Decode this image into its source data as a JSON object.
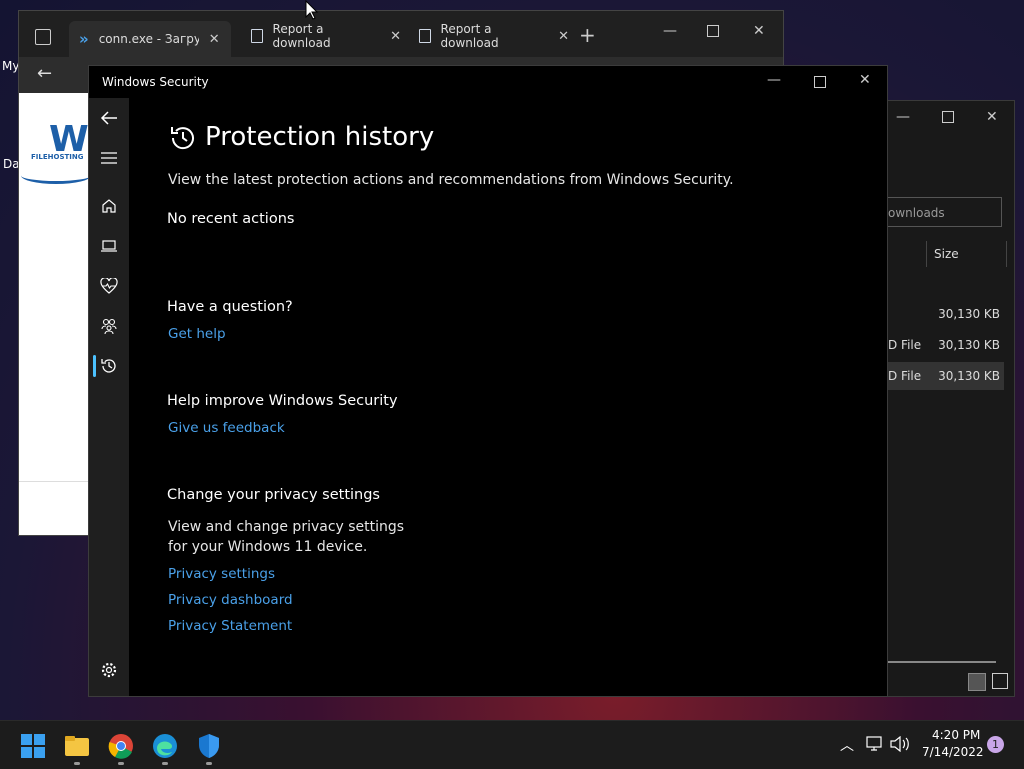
{
  "desktop": {
    "label_my": "My",
    "label_da": "Da"
  },
  "browser": {
    "tabs": [
      {
        "label": "conn.exe - Загрузи"
      },
      {
        "label": "Report a download"
      },
      {
        "label": "Report a download"
      }
    ],
    "logo_text": "W",
    "logo_sub": "FILEHOSTING"
  },
  "explorer": {
    "search_placeholder": "ownloads",
    "size_header": "Size",
    "rows": [
      {
        "type": "",
        "size": "30,130 KB"
      },
      {
        "type": "D File",
        "size": "30,130 KB"
      },
      {
        "type": "D File",
        "size": "30,130 KB"
      }
    ]
  },
  "security": {
    "window_title": "Windows Security",
    "page_title": "Protection history",
    "description": "View the latest protection actions and recommendations from Windows Security.",
    "no_actions": "No recent actions",
    "question_heading": "Have a question?",
    "get_help": "Get help",
    "improve_heading": "Help improve Windows Security",
    "feedback": "Give us feedback",
    "privacy_heading": "Change your privacy settings",
    "privacy_desc_1": "View and change privacy settings",
    "privacy_desc_2": "for your Windows 11 device.",
    "privacy_settings": "Privacy settings",
    "privacy_dashboard": "Privacy dashboard",
    "privacy_statement": "Privacy Statement"
  },
  "taskbar": {
    "time": "4:20 PM",
    "date": "7/14/2022",
    "notification_count": "1"
  },
  "colors": {
    "accent": "#4cc2ff",
    "link": "#4aa0e8"
  }
}
